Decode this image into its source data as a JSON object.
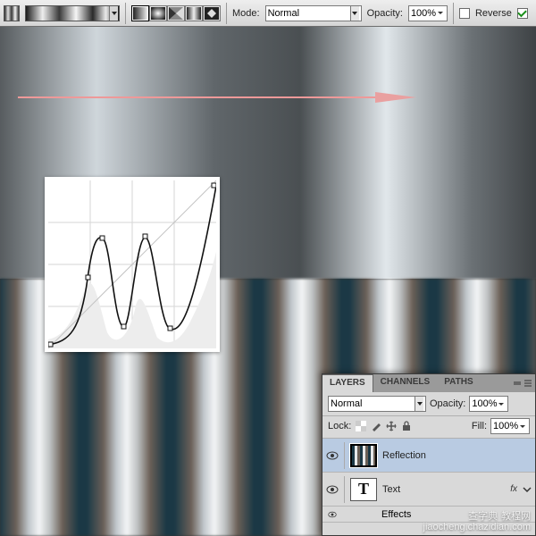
{
  "optionsBar": {
    "modeLabel": "Mode:",
    "modeValue": "Normal",
    "opacityLabel": "Opacity:",
    "opacityValue": "100%",
    "reverseLabel": "Reverse",
    "reverseChecked": false,
    "ditherChecked": true
  },
  "layersPanel": {
    "tabs": {
      "layers": "LAYERS",
      "channels": "CHANNELS",
      "paths": "PATHS"
    },
    "blendMode": "Normal",
    "opacityLabel": "Opacity:",
    "opacityValue": "100%",
    "lockLabel": "Lock:",
    "fillLabel": "Fill:",
    "fillValue": "100%",
    "layers": [
      {
        "name": "Reflection",
        "visible": true,
        "selected": true,
        "fx": false
      },
      {
        "name": "Text",
        "visible": true,
        "selected": false,
        "fx": true
      }
    ],
    "effectsLabel": "Effects",
    "fxLabel": "fx"
  },
  "watermark": {
    "line1": "查字典",
    "line2": "教程网",
    "url": "jiaocheng.chazidian.com"
  }
}
